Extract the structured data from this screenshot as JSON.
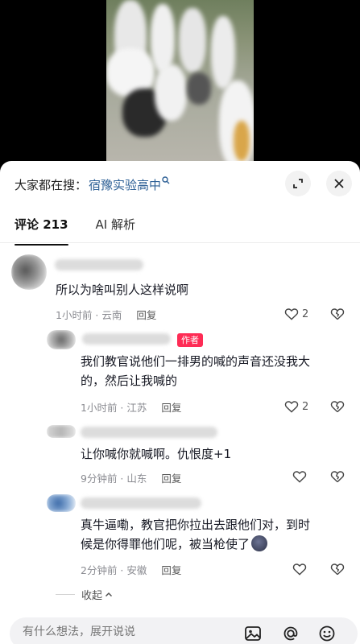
{
  "search": {
    "prefix": "大家都在搜：",
    "keyword": "宿豫实验高中"
  },
  "tabs": [
    {
      "label": "评论 213",
      "active": true
    },
    {
      "label": "AI 解析",
      "active": false
    }
  ],
  "comments": [
    {
      "text": "所以为啥叫别人这样说啊",
      "meta": "1小时前 · 云南",
      "reply": "回复",
      "likes": "2"
    },
    {
      "badge": "作者",
      "text_line1": "我们教官说他们一排男的喊的声音还没我大",
      "text_line2": "的，然后让我喊的",
      "meta": "1小时前 · 江苏",
      "reply": "回复",
      "likes": "2"
    },
    {
      "text": "让你喊你就喊啊。仇恨度+1",
      "meta": "9分钟前 · 山东",
      "reply": "回复",
      "likes": ""
    },
    {
      "text_line1": "真牛逼嘞，教官把你拉出去跟他们对，到时",
      "text_line2": "候是你得罪他们呢，被当枪使了",
      "meta": "2分钟前 · 安徽",
      "reply": "回复",
      "likes": ""
    }
  ],
  "collapse": {
    "label": "收起"
  },
  "input": {
    "placeholder": "有什么想法，展开说说"
  },
  "icons": {
    "search": "search-icon",
    "expand": "expand-icon",
    "close": "close-icon",
    "like": "heart-icon",
    "dislike": "broken-heart-icon",
    "image": "image-icon",
    "mention": "at-icon",
    "emoji": "emoji-icon"
  },
  "colors": {
    "accent": "#fe2c55",
    "link": "#2c5f95"
  }
}
